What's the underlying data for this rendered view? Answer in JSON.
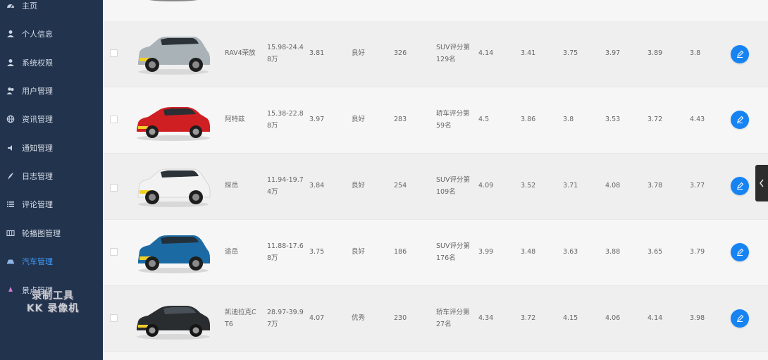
{
  "sidebar": {
    "items": [
      {
        "label": "主页",
        "icon": "dashboard-icon"
      },
      {
        "label": "个人信息",
        "icon": "user-icon"
      },
      {
        "label": "系统权限",
        "icon": "user-key-icon"
      },
      {
        "label": "用户管理",
        "icon": "users-icon"
      },
      {
        "label": "资讯管理",
        "icon": "globe-icon"
      },
      {
        "label": "通知管理",
        "icon": "bell-icon"
      },
      {
        "label": "日志管理",
        "icon": "pen-icon"
      },
      {
        "label": "评论管理",
        "icon": "list-icon"
      },
      {
        "label": "轮播图管理",
        "icon": "image-icon"
      },
      {
        "label": "汽车管理",
        "icon": "car-icon"
      },
      {
        "label": "景点管理",
        "icon": "location-icon"
      }
    ],
    "active_index": 9,
    "accent_color": "#409eff"
  },
  "watermark": {
    "line1": "录制工具",
    "line2": "KK 录像机"
  },
  "table": {
    "rows": [
      {
        "name": "RAV4荣放",
        "price_line1": "15.98-24.4",
        "price_line2": "8万",
        "score": "3.81",
        "rating": "良好",
        "count": "326",
        "rank_line1": "SUV评分第",
        "rank_line2": "129名",
        "s1": "4.14",
        "s2": "3.41",
        "s3": "3.75",
        "s4": "3.97",
        "s5": "3.89",
        "s6": "3.8",
        "car_color": "#a9b2b7"
      },
      {
        "name": "阿特兹",
        "price_line1": "15.38-22.8",
        "price_line2": "8万",
        "score": "3.97",
        "rating": "良好",
        "count": "283",
        "rank_line1": "轿车评分第",
        "rank_line2": "59名",
        "s1": "4.5",
        "s2": "3.86",
        "s3": "3.8",
        "s4": "3.53",
        "s5": "3.72",
        "s6": "4.43",
        "car_color": "#d01f22"
      },
      {
        "name": "探岳",
        "price_line1": "11.94-19.7",
        "price_line2": "4万",
        "score": "3.84",
        "rating": "良好",
        "count": "254",
        "rank_line1": "SUV评分第",
        "rank_line2": "109名",
        "s1": "4.09",
        "s2": "3.52",
        "s3": "3.71",
        "s4": "4.08",
        "s5": "3.78",
        "s6": "3.77",
        "car_color": "#f2f2f2"
      },
      {
        "name": "途岳",
        "price_line1": "11.88-17.6",
        "price_line2": "8万",
        "score": "3.75",
        "rating": "良好",
        "count": "186",
        "rank_line1": "SUV评分第",
        "rank_line2": "176名",
        "s1": "3.99",
        "s2": "3.48",
        "s3": "3.63",
        "s4": "3.88",
        "s5": "3.65",
        "s6": "3.79",
        "car_color": "#1c6aa3"
      },
      {
        "name": "凯迪拉克C",
        "name_line2": "T6",
        "price_line1": "28.97-39.9",
        "price_line2": "7万",
        "score": "4.07",
        "rating": "优秀",
        "count": "230",
        "rank_line1": "轿车评分第",
        "rank_line2": "27名",
        "s1": "4.34",
        "s2": "3.72",
        "s3": "4.15",
        "s4": "4.06",
        "s5": "4.14",
        "s6": "3.98",
        "car_color": "#2a2d30"
      }
    ]
  },
  "colors": {
    "sidebar_bg": "#22334d",
    "edit_button": "#1683f3"
  }
}
